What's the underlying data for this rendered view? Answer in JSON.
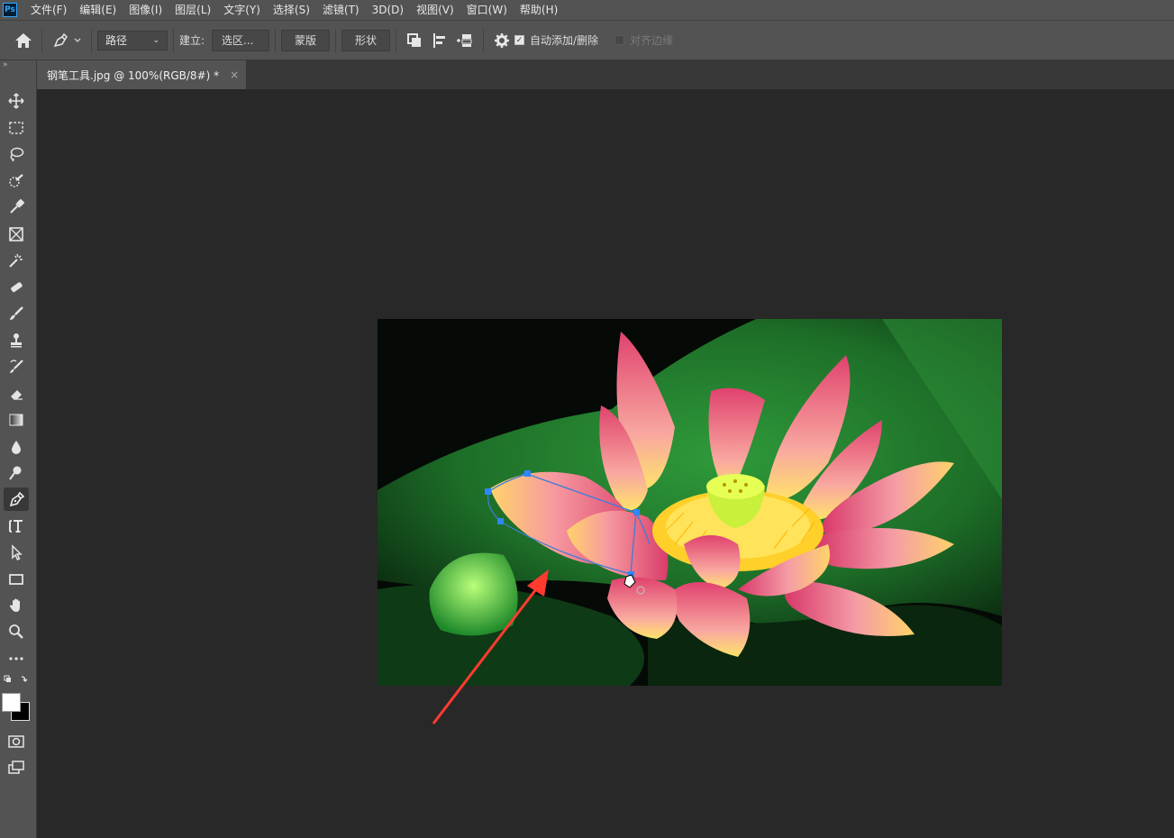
{
  "app": {
    "logo_text": "Ps"
  },
  "menubar": {
    "items": [
      "文件(F)",
      "编辑(E)",
      "图像(I)",
      "图层(L)",
      "文字(Y)",
      "选择(S)",
      "滤镜(T)",
      "3D(D)",
      "视图(V)",
      "窗口(W)",
      "帮助(H)"
    ]
  },
  "options": {
    "mode_value": "路径",
    "make_label": "建立:",
    "selection_button": "选区...",
    "mask_button": "蒙版",
    "shape_button": "形状",
    "auto_add_delete_label": "自动添加/删除",
    "align_edges_label": "对齐边缘",
    "auto_add_delete_checked": true,
    "align_edges_checked": false
  },
  "document": {
    "tab_title": "钢笔工具.jpg @ 100%(RGB/8#) *",
    "close_symbol": "×"
  },
  "toolbar": {
    "collapse_symbol": "»",
    "tools": [
      "move-tool",
      "marquee-tool",
      "lasso-tool",
      "quick-selection-tool",
      "eyedropper-tool",
      "frame-tool",
      "spot-healing-tool",
      "eraser-tool",
      "brush-tool",
      "clone-stamp-tool",
      "history-brush-tool",
      "eraser2-tool",
      "gradient-tool",
      "blur-tool",
      "dodge-tool",
      "pen-tool",
      "type-tool",
      "path-selection-tool",
      "rectangle-tool",
      "hand-tool",
      "zoom-tool",
      "more-tools"
    ],
    "active_tool": "pen-tool"
  },
  "colors": {
    "ui_panel": "#535353",
    "canvas_bg": "#282828",
    "path_blue": "#2f86ff",
    "annotation_arrow": "#ff3b30"
  }
}
